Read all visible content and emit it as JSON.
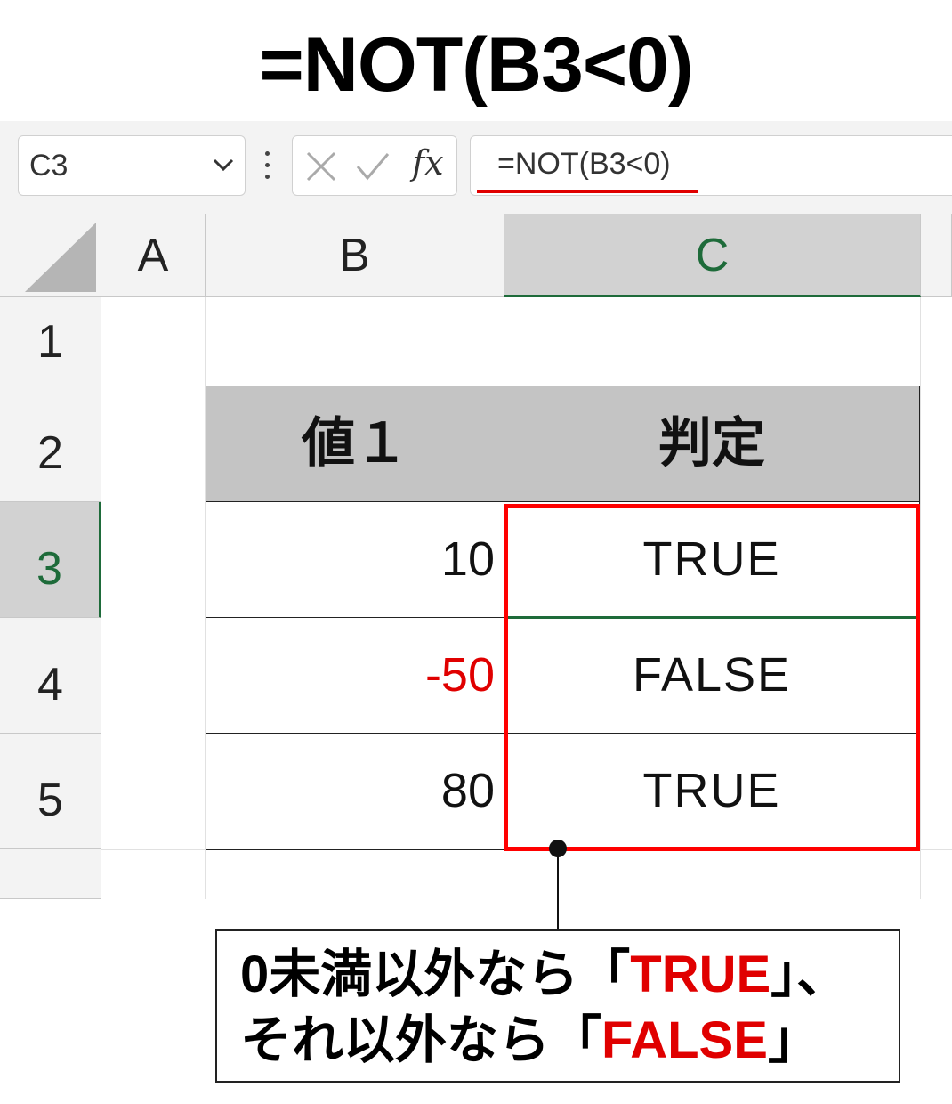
{
  "title": "=NOT(B3<0)",
  "toolbar": {
    "name_box": "C3",
    "fx_label": "fx",
    "formula": "=NOT(B3<0)"
  },
  "columns": [
    "A",
    "B",
    "C"
  ],
  "rows": [
    "1",
    "2",
    "3",
    "4",
    "5"
  ],
  "table": {
    "headers": [
      "値１",
      "判定"
    ],
    "rows": [
      {
        "value": "10",
        "result": "TRUE"
      },
      {
        "value": "-50",
        "result": "FALSE"
      },
      {
        "value": "80",
        "result": "TRUE"
      }
    ]
  },
  "callout": {
    "line1_prefix": "0未満以外なら「",
    "line1_highlight": "TRUE",
    "line1_suffix": "」、",
    "line2_prefix": "それ以外なら「",
    "line2_highlight": "FALSE",
    "line2_suffix": "」"
  },
  "colors": {
    "accent_red": "#ff0000",
    "selection_green": "#1e6b3a",
    "header_gray": "#c4c4c4"
  }
}
